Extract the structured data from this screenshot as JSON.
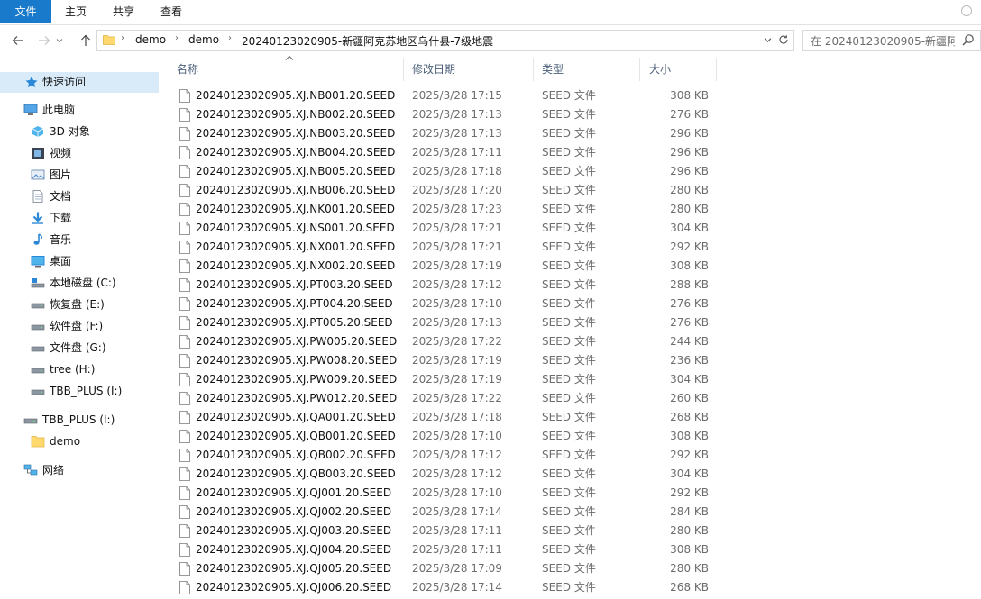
{
  "ribbon": {
    "file_tab": "文件",
    "tabs": [
      "主页",
      "共享",
      "查看"
    ]
  },
  "address": {
    "crumbs": [
      "demo",
      "demo",
      "20240123020905-新疆阿克苏地区乌什县-7级地震"
    ]
  },
  "search": {
    "placeholder": "在 20240123020905-新疆阿..."
  },
  "sidebar": {
    "quick_access": "快速访问",
    "this_pc": "此电脑",
    "items": [
      "3D 对象",
      "视频",
      "图片",
      "文档",
      "下载",
      "音乐",
      "桌面",
      "本地磁盘 (C:)",
      "恢复盘 (E:)",
      "软件盘 (F:)",
      "文件盘 (G:)",
      "tree (H:)",
      "TBB_PLUS (I:)"
    ],
    "drive": "TBB_PLUS (I:)",
    "folder": "demo",
    "network": "网络"
  },
  "columns": {
    "name": "名称",
    "date": "修改日期",
    "type": "类型",
    "size": "大小"
  },
  "files": [
    {
      "name": "20240123020905.XJ.NB001.20.SEED",
      "date": "2025/3/28 17:15",
      "type": "SEED 文件",
      "size": "308 KB"
    },
    {
      "name": "20240123020905.XJ.NB002.20.SEED",
      "date": "2025/3/28 17:13",
      "type": "SEED 文件",
      "size": "276 KB"
    },
    {
      "name": "20240123020905.XJ.NB003.20.SEED",
      "date": "2025/3/28 17:13",
      "type": "SEED 文件",
      "size": "296 KB"
    },
    {
      "name": "20240123020905.XJ.NB004.20.SEED",
      "date": "2025/3/28 17:11",
      "type": "SEED 文件",
      "size": "296 KB"
    },
    {
      "name": "20240123020905.XJ.NB005.20.SEED",
      "date": "2025/3/28 17:18",
      "type": "SEED 文件",
      "size": "296 KB"
    },
    {
      "name": "20240123020905.XJ.NB006.20.SEED",
      "date": "2025/3/28 17:20",
      "type": "SEED 文件",
      "size": "280 KB"
    },
    {
      "name": "20240123020905.XJ.NK001.20.SEED",
      "date": "2025/3/28 17:23",
      "type": "SEED 文件",
      "size": "280 KB"
    },
    {
      "name": "20240123020905.XJ.NS001.20.SEED",
      "date": "2025/3/28 17:21",
      "type": "SEED 文件",
      "size": "304 KB"
    },
    {
      "name": "20240123020905.XJ.NX001.20.SEED",
      "date": "2025/3/28 17:21",
      "type": "SEED 文件",
      "size": "292 KB"
    },
    {
      "name": "20240123020905.XJ.NX002.20.SEED",
      "date": "2025/3/28 17:19",
      "type": "SEED 文件",
      "size": "308 KB"
    },
    {
      "name": "20240123020905.XJ.PT003.20.SEED",
      "date": "2025/3/28 17:12",
      "type": "SEED 文件",
      "size": "288 KB"
    },
    {
      "name": "20240123020905.XJ.PT004.20.SEED",
      "date": "2025/3/28 17:10",
      "type": "SEED 文件",
      "size": "276 KB"
    },
    {
      "name": "20240123020905.XJ.PT005.20.SEED",
      "date": "2025/3/28 17:13",
      "type": "SEED 文件",
      "size": "276 KB"
    },
    {
      "name": "20240123020905.XJ.PW005.20.SEED",
      "date": "2025/3/28 17:22",
      "type": "SEED 文件",
      "size": "244 KB"
    },
    {
      "name": "20240123020905.XJ.PW008.20.SEED",
      "date": "2025/3/28 17:19",
      "type": "SEED 文件",
      "size": "236 KB"
    },
    {
      "name": "20240123020905.XJ.PW009.20.SEED",
      "date": "2025/3/28 17:19",
      "type": "SEED 文件",
      "size": "304 KB"
    },
    {
      "name": "20240123020905.XJ.PW012.20.SEED",
      "date": "2025/3/28 17:22",
      "type": "SEED 文件",
      "size": "260 KB"
    },
    {
      "name": "20240123020905.XJ.QA001.20.SEED",
      "date": "2025/3/28 17:18",
      "type": "SEED 文件",
      "size": "268 KB"
    },
    {
      "name": "20240123020905.XJ.QB001.20.SEED",
      "date": "2025/3/28 17:10",
      "type": "SEED 文件",
      "size": "308 KB"
    },
    {
      "name": "20240123020905.XJ.QB002.20.SEED",
      "date": "2025/3/28 17:12",
      "type": "SEED 文件",
      "size": "292 KB"
    },
    {
      "name": "20240123020905.XJ.QB003.20.SEED",
      "date": "2025/3/28 17:12",
      "type": "SEED 文件",
      "size": "304 KB"
    },
    {
      "name": "20240123020905.XJ.QJ001.20.SEED",
      "date": "2025/3/28 17:10",
      "type": "SEED 文件",
      "size": "292 KB"
    },
    {
      "name": "20240123020905.XJ.QJ002.20.SEED",
      "date": "2025/3/28 17:14",
      "type": "SEED 文件",
      "size": "284 KB"
    },
    {
      "name": "20240123020905.XJ.QJ003.20.SEED",
      "date": "2025/3/28 17:11",
      "type": "SEED 文件",
      "size": "280 KB"
    },
    {
      "name": "20240123020905.XJ.QJ004.20.SEED",
      "date": "2025/3/28 17:11",
      "type": "SEED 文件",
      "size": "308 KB"
    },
    {
      "name": "20240123020905.XJ.QJ005.20.SEED",
      "date": "2025/3/28 17:09",
      "type": "SEED 文件",
      "size": "280 KB"
    },
    {
      "name": "20240123020905.XJ.QJ006.20.SEED",
      "date": "2025/3/28 17:14",
      "type": "SEED 文件",
      "size": "268 KB"
    }
  ]
}
